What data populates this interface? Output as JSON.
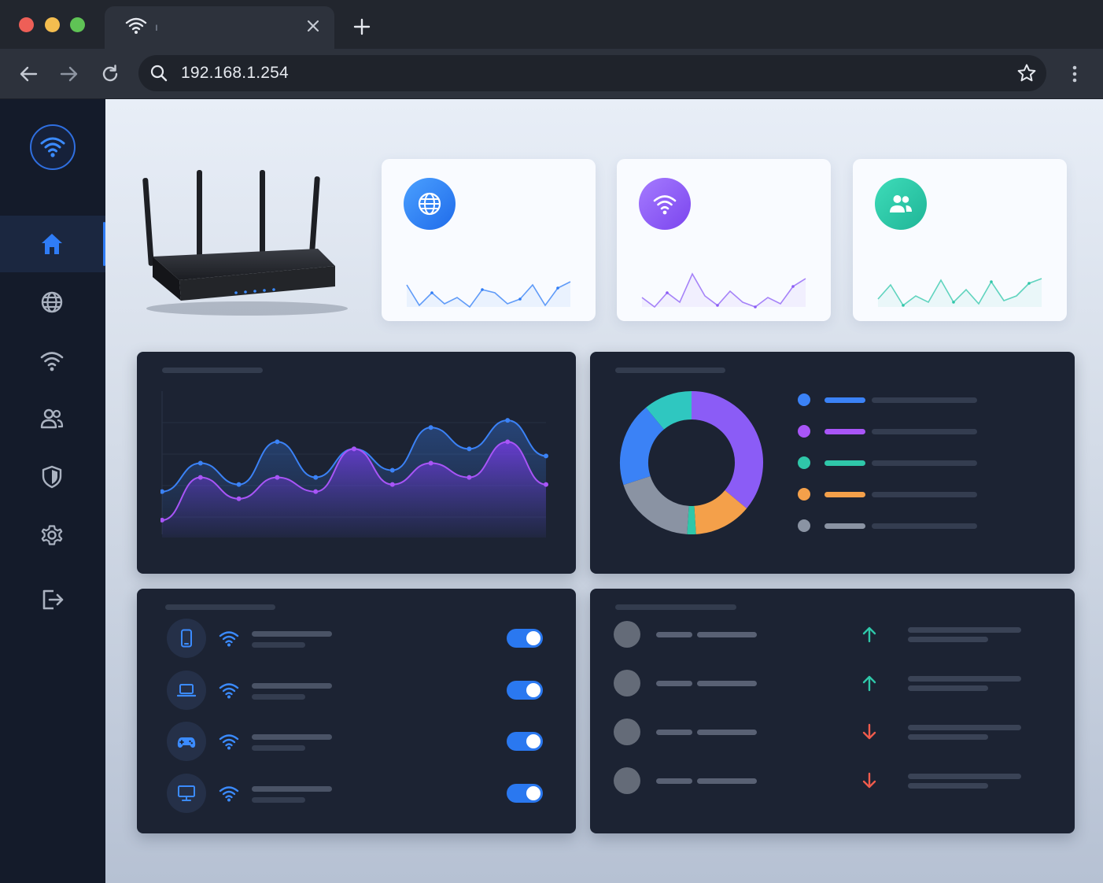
{
  "browser": {
    "tab_title": "ı",
    "url": "192.168.1.254",
    "traffic_colors": [
      "#ee5f57",
      "#f4bd4f",
      "#5fc355"
    ]
  },
  "sidebar": {
    "items": [
      {
        "icon": "home-icon",
        "active": true
      },
      {
        "icon": "globe-icon",
        "active": false
      },
      {
        "icon": "wifi-icon",
        "active": false
      },
      {
        "icon": "users-icon",
        "active": false
      },
      {
        "icon": "shield-icon",
        "active": false
      },
      {
        "icon": "gear-icon",
        "active": false
      },
      {
        "icon": "logout-icon",
        "active": false
      }
    ]
  },
  "stat_cards": [
    {
      "icon": "globe-icon",
      "color": "#2f7cf6"
    },
    {
      "icon": "wifi-icon",
      "color": "#8b5cf6"
    },
    {
      "icon": "users-icon",
      "color": "#2fc7a9"
    }
  ],
  "traffic_chart": {
    "type": "line",
    "series": [
      {
        "color": "#3b82f6",
        "values": [
          3,
          5,
          3.5,
          6.5,
          4,
          6,
          4.5,
          7.5,
          6,
          8,
          5.5
        ]
      },
      {
        "color": "#a855f7",
        "values": [
          1,
          4,
          2.5,
          4,
          3,
          6,
          3.5,
          5,
          4,
          6.5,
          3.5
        ]
      }
    ]
  },
  "usage_donut": {
    "type": "pie",
    "segments": [
      {
        "color": "#8b5cf6",
        "value": 36
      },
      {
        "color": "#f4a04a",
        "value": 13
      },
      {
        "color": "#2fc7a9",
        "value": 2
      },
      {
        "color": "#8a93a3",
        "value": 19
      },
      {
        "color": "#3b82f6",
        "value": 19
      },
      {
        "color": "#2fc7c0",
        "value": 11
      }
    ],
    "legend_colors": [
      "#3b82f6",
      "#a855f7",
      "#2fc7a9",
      "#f4a04a",
      "#8a93a3"
    ]
  },
  "devices": [
    {
      "icon": "phone-icon",
      "enabled": true
    },
    {
      "icon": "laptop-icon",
      "enabled": true
    },
    {
      "icon": "gamepad-icon",
      "enabled": true
    },
    {
      "icon": "monitor-icon",
      "enabled": true
    }
  ],
  "activity": [
    {
      "direction": "up",
      "color": "#2fc7a9"
    },
    {
      "direction": "up",
      "color": "#2fc7a9"
    },
    {
      "direction": "down",
      "color": "#ef5b4c"
    },
    {
      "direction": "down",
      "color": "#ef5b4c"
    }
  ]
}
